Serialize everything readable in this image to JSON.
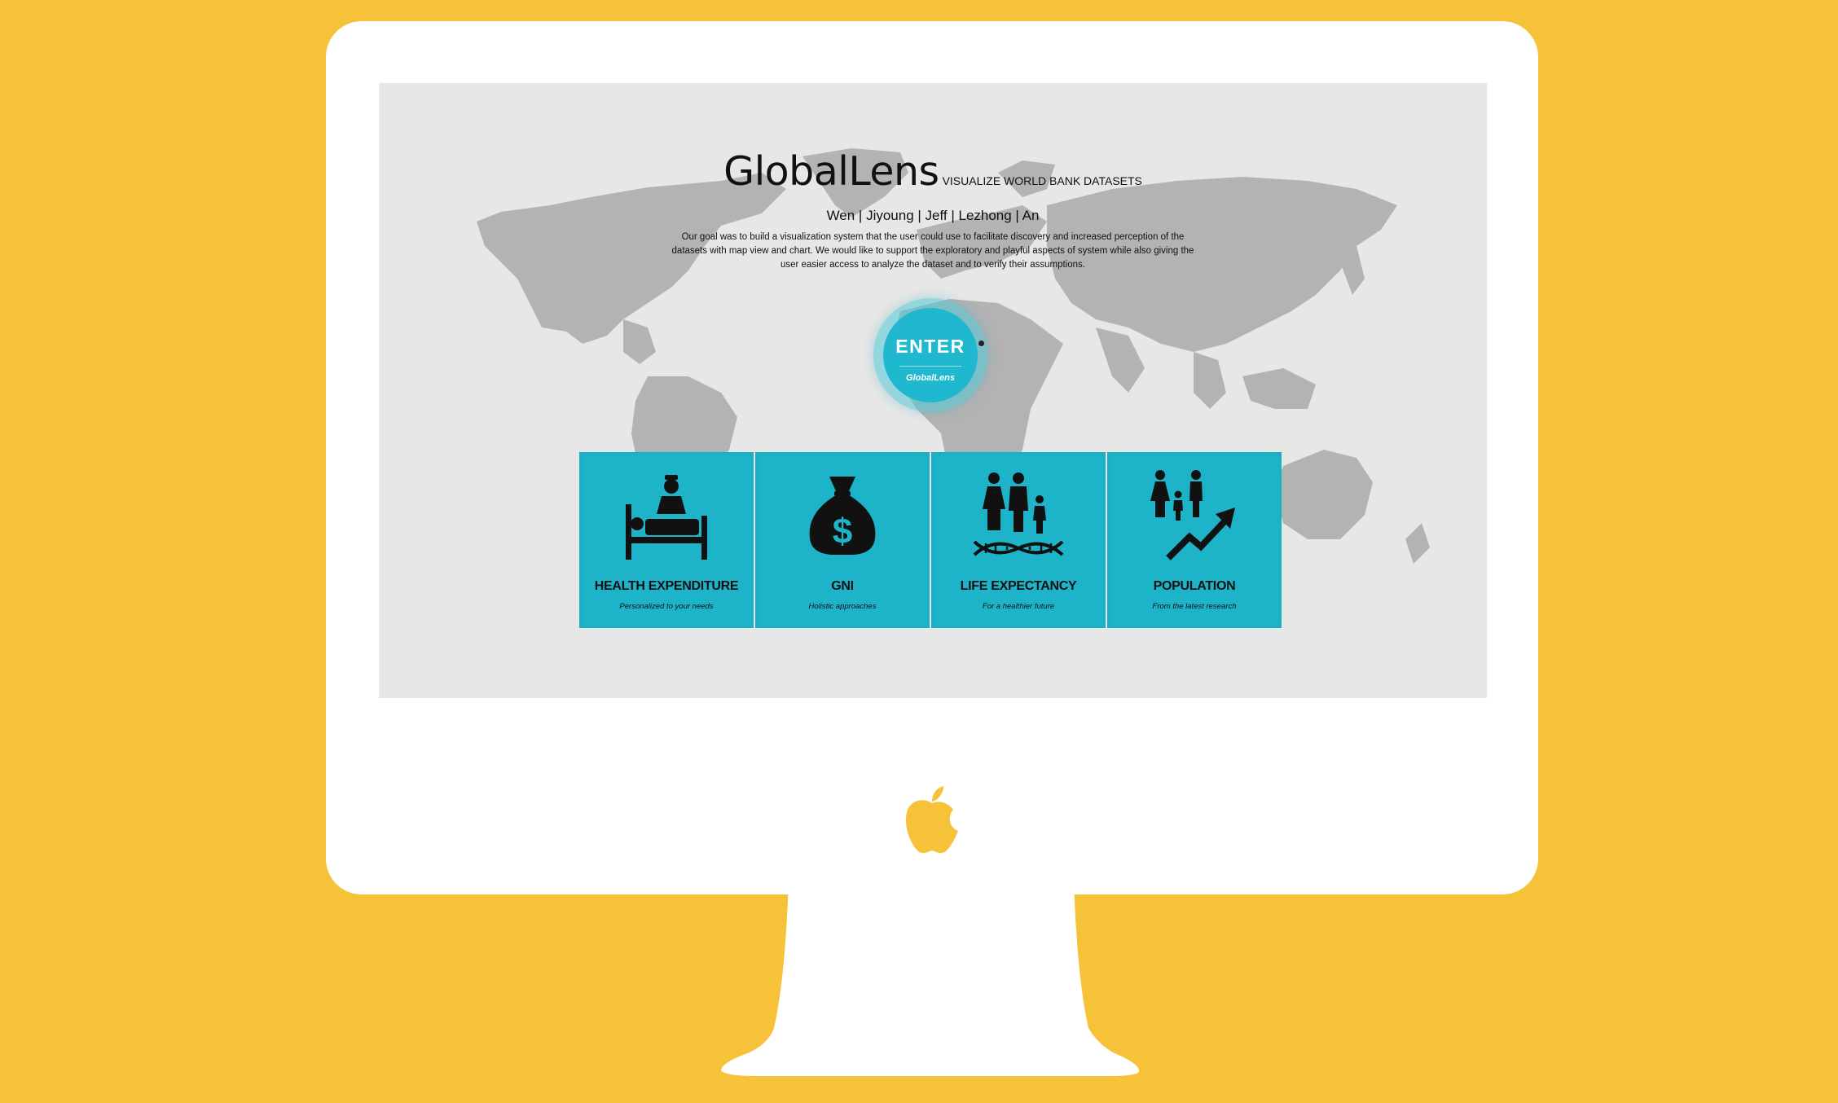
{
  "header": {
    "title": "GlobalLens",
    "subtitle": "VISUALIZE WORLD BANK DATASETS",
    "team": "Wen | Jiyoung | Jeff | Lezhong | An",
    "description": "Our goal was to build a visualization system that the user could use to facilitate discovery and increased perception of the datasets with map view and chart. We would like to support the exploratory and playful aspects of system while also giving the user easier access to analyze the dataset and to verify their assumptions."
  },
  "enter": {
    "label": "ENTER",
    "sub": "GlobalLens"
  },
  "cards": [
    {
      "title": "HEALTH EXPENDITURE",
      "sub": "Personalized to your needs",
      "icon": "hospital-bed-icon"
    },
    {
      "title": "GNI",
      "sub": "Holistic approaches",
      "icon": "money-bag-icon"
    },
    {
      "title": "LIFE EXPECTANCY",
      "sub": "For a healthier future",
      "icon": "family-dna-icon"
    },
    {
      "title": "POPULATION",
      "sub": "From the latest research",
      "icon": "population-growth-icon"
    }
  ],
  "colors": {
    "background": "#F6C23A",
    "accent": "#1DB4CA",
    "map": "#B3B3B3",
    "screen": "#E7E7E7"
  }
}
